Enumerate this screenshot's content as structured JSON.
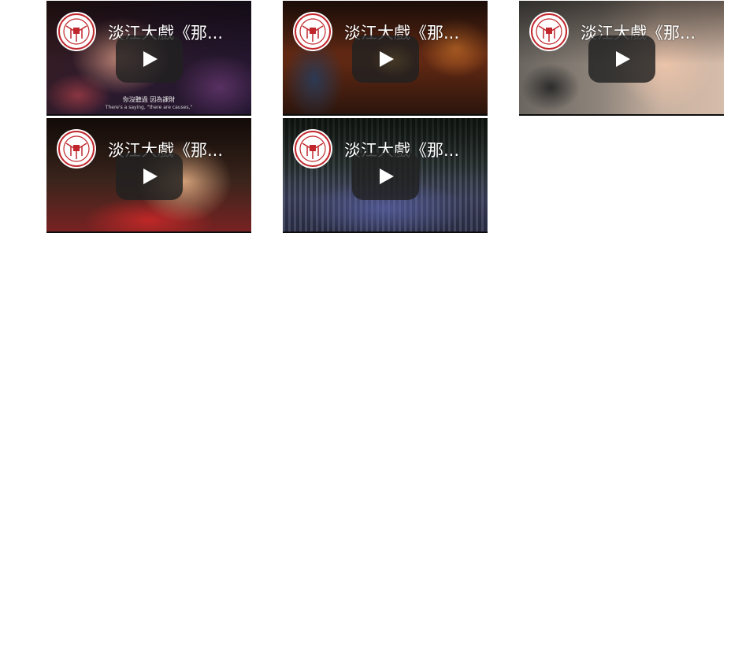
{
  "videos": [
    {
      "title": "淡江大戲《那...",
      "caption_zh": "你沒聽過 因為課財",
      "caption_en": "There's a saying, \"there are causes,\""
    },
    {
      "title": "淡江大戲《那..."
    },
    {
      "title": "淡江大戲《那..."
    },
    {
      "title": "淡江大戲《那..."
    },
    {
      "title": "淡江大戲《那..."
    }
  ],
  "icons": {
    "logo": "university-seal-icon",
    "play": "play-button-icon"
  },
  "colors": {
    "play_bg": "#212121",
    "seal_red": "#c0272d"
  }
}
